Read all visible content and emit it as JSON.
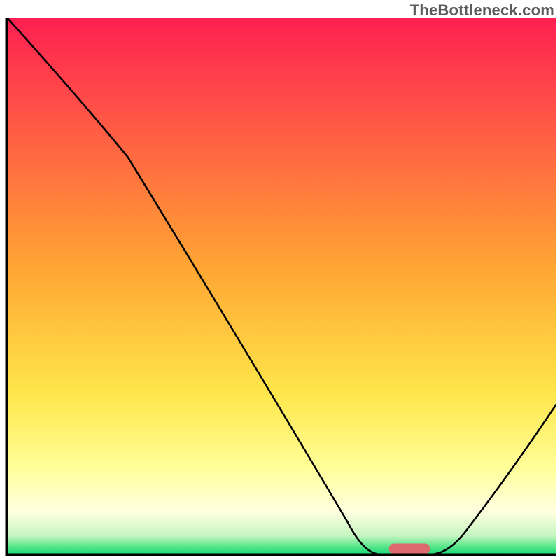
{
  "watermark": "TheBottleneck.com",
  "chart_data": {
    "type": "line",
    "title": "",
    "xlabel": "",
    "ylabel": "",
    "xlim": [
      0,
      100
    ],
    "ylim": [
      0,
      100
    ],
    "grid": false,
    "background": {
      "type": "vertical-gradient",
      "stops": [
        {
          "pos": 0.0,
          "color": "#ff1f52"
        },
        {
          "pos": 0.47,
          "color": "#ffa733"
        },
        {
          "pos": 0.7,
          "color": "#ffe64a"
        },
        {
          "pos": 0.84,
          "color": "#ffff9a"
        },
        {
          "pos": 0.92,
          "color": "#ffffe0"
        },
        {
          "pos": 0.965,
          "color": "#c7f6c2"
        },
        {
          "pos": 0.985,
          "color": "#5ae68a"
        },
        {
          "pos": 1.0,
          "color": "#17d977"
        }
      ]
    },
    "series": [
      {
        "name": "bottleneck-curve",
        "color": "#000000",
        "points": [
          {
            "x": 0.0,
            "y": 100.0
          },
          {
            "x": 14.0,
            "y": 84.0
          },
          {
            "x": 22.0,
            "y": 74.0
          },
          {
            "x": 62.0,
            "y": 6.0
          },
          {
            "x": 68.0,
            "y": 0.0
          },
          {
            "x": 77.0,
            "y": 0.0
          },
          {
            "x": 84.0,
            "y": 5.0
          },
          {
            "x": 100.0,
            "y": 28.0
          }
        ]
      }
    ],
    "marker": {
      "name": "optimal-range",
      "color": "#dd6a6c",
      "x_start": 69.5,
      "x_end": 77.0,
      "thickness": 2.0
    },
    "axes": {
      "left": {
        "visible": true,
        "thickness": 4,
        "color": "#000000"
      },
      "bottom": {
        "visible": true,
        "thickness": 4,
        "color": "#000000"
      }
    }
  }
}
